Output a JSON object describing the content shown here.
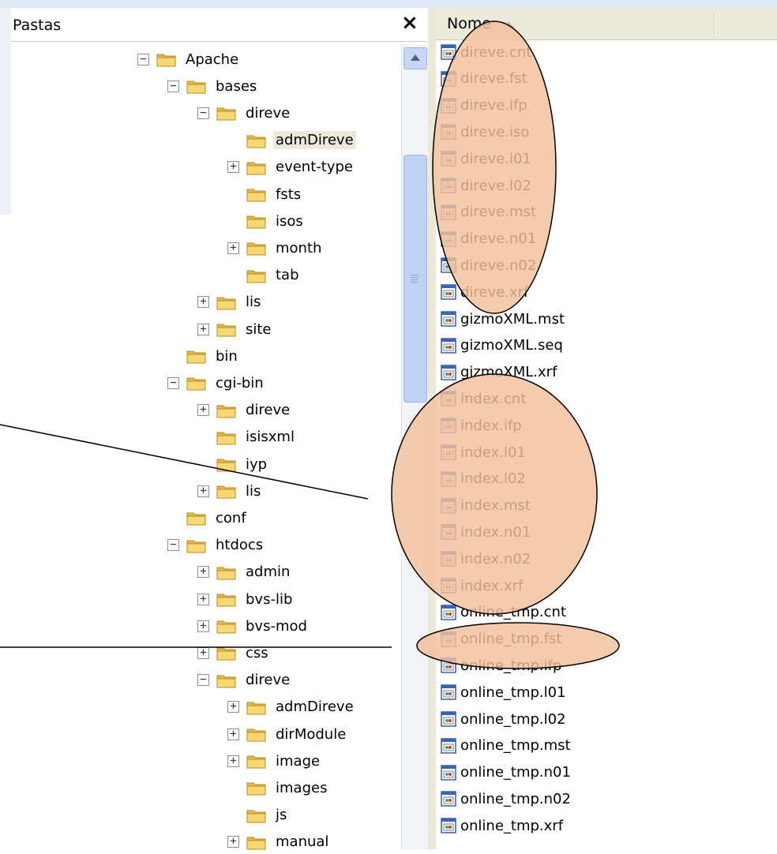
{
  "left_pane": {
    "title": "Pastas",
    "close_glyph": "×",
    "tree": [
      {
        "label": "Apache",
        "toggle": "⊟"
      },
      {
        "label": "bases",
        "toggle": "⊟"
      },
      {
        "label": "direve",
        "toggle": "⊟"
      },
      {
        "label": "admDireve",
        "toggle": "",
        "selected": true
      },
      {
        "label": "event-type",
        "toggle": "⊞"
      },
      {
        "label": "fsts",
        "toggle": ""
      },
      {
        "label": "isos",
        "toggle": ""
      },
      {
        "label": "month",
        "toggle": "⊞"
      },
      {
        "label": "tab",
        "toggle": ""
      },
      {
        "label": "lis",
        "toggle": "⊞"
      },
      {
        "label": "site",
        "toggle": "⊞"
      },
      {
        "label": "bin",
        "toggle": ""
      },
      {
        "label": "cgi-bin",
        "toggle": "⊟"
      },
      {
        "label": "direve",
        "toggle": "⊞"
      },
      {
        "label": "isisxml",
        "toggle": ""
      },
      {
        "label": "iyp",
        "toggle": ""
      },
      {
        "label": "lis",
        "toggle": "⊞"
      },
      {
        "label": "conf",
        "toggle": ""
      },
      {
        "label": "htdocs",
        "toggle": "⊟"
      },
      {
        "label": "admin",
        "toggle": "⊞"
      },
      {
        "label": "bvs-lib",
        "toggle": "⊞"
      },
      {
        "label": "bvs-mod",
        "toggle": "⊞"
      },
      {
        "label": "css",
        "toggle": "⊞"
      },
      {
        "label": "direve",
        "toggle": "⊟"
      },
      {
        "label": "admDireve",
        "toggle": "⊞"
      },
      {
        "label": "dirModule",
        "toggle": "⊞"
      },
      {
        "label": "image",
        "toggle": "⊞"
      },
      {
        "label": "images",
        "toggle": ""
      },
      {
        "label": "js",
        "toggle": ""
      },
      {
        "label": "manual",
        "toggle": "⊞"
      }
    ]
  },
  "right_pane": {
    "column_header": "Nome",
    "sort": "ascending",
    "files": [
      "direve.cnt",
      "direve.fst",
      "direve.ifp",
      "direve.iso",
      "direve.l01",
      "direve.l02",
      "direve.mst",
      "direve.n01",
      "direve.n02",
      "direve.xrf",
      "gizmoXML.mst",
      "gizmoXML.seq",
      "gizmoXML.xrf",
      "index.cnt",
      "index.ifp",
      "index.l01",
      "index.l02",
      "index.mst",
      "index.n01",
      "index.n02",
      "index.xrf",
      "online_tmp.cnt",
      "online_tmp.fst",
      "online_tmp.ifp",
      "online_tmp.l01",
      "online_tmp.l02",
      "online_tmp.mst",
      "online_tmp.n01",
      "online_tmp.n02",
      "online_tmp.xrf"
    ]
  },
  "colors": {
    "highlight_fill": "#f3c09c",
    "folder": "#f4d36a",
    "window_accent": "#dfe9f5"
  }
}
